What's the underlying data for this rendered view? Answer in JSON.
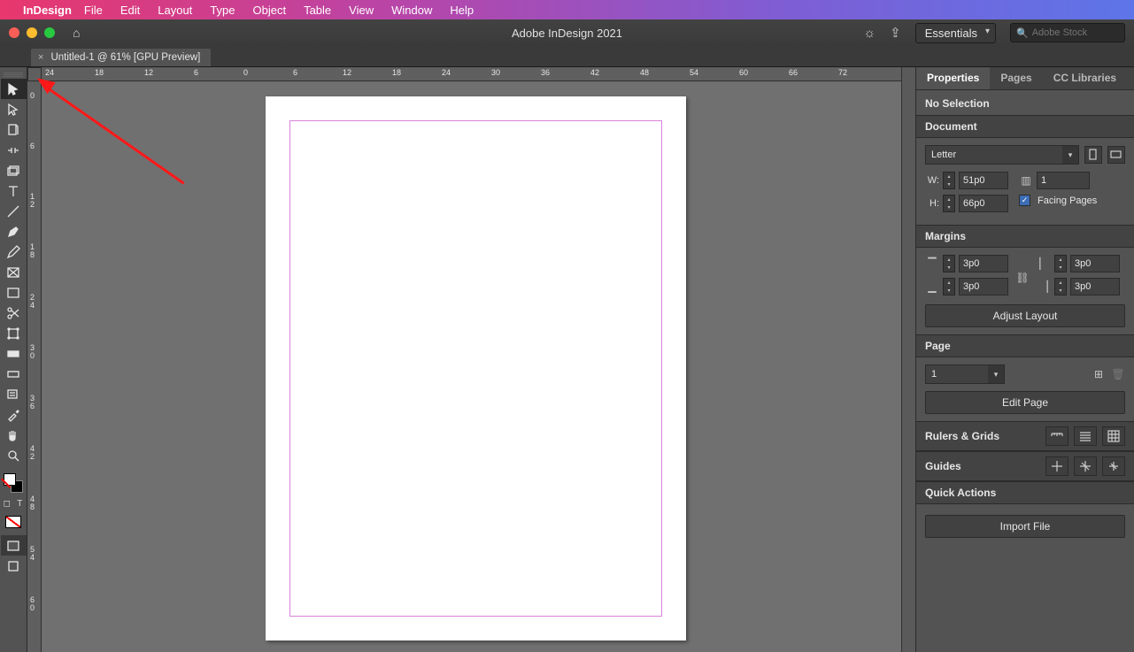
{
  "menubar": {
    "app": "InDesign",
    "items": [
      "File",
      "Edit",
      "Layout",
      "Type",
      "Object",
      "Table",
      "View",
      "Window",
      "Help"
    ]
  },
  "titlebar": {
    "title": "Adobe InDesign 2021",
    "workspace": "Essentials",
    "search_placeholder": "Adobe Stock"
  },
  "document_tab": {
    "label": "Untitled-1 @ 61% [GPU Preview]"
  },
  "ruler_h": [
    "24",
    "18",
    "12",
    "6",
    "0",
    "6",
    "12",
    "18",
    "24",
    "30",
    "36",
    "42",
    "48",
    "54",
    "60",
    "66",
    "72"
  ],
  "ruler_v": [
    "0",
    "6",
    "1\n2",
    "1\n8",
    "2\n4",
    "3\n0",
    "3\n6",
    "4\n2",
    "4\n8",
    "5\n4",
    "6\n0"
  ],
  "panel": {
    "tabs": [
      "Properties",
      "Pages",
      "CC Libraries"
    ],
    "no_selection": "No Selection",
    "document": {
      "title": "Document",
      "preset": "Letter",
      "w_label": "W:",
      "w": "51p0",
      "h_label": "H:",
      "h": "66p0",
      "pages_val": "1",
      "facing_label": "Facing Pages"
    },
    "margins": {
      "title": "Margins",
      "top": "3p0",
      "bottom": "3p0",
      "left": "3p0",
      "right": "3p0",
      "adjust": "Adjust Layout"
    },
    "page": {
      "title": "Page",
      "num": "1",
      "edit": "Edit Page"
    },
    "rulers": {
      "title": "Rulers & Grids"
    },
    "guides": {
      "title": "Guides"
    },
    "quick": {
      "title": "Quick Actions",
      "import": "Import File"
    }
  }
}
